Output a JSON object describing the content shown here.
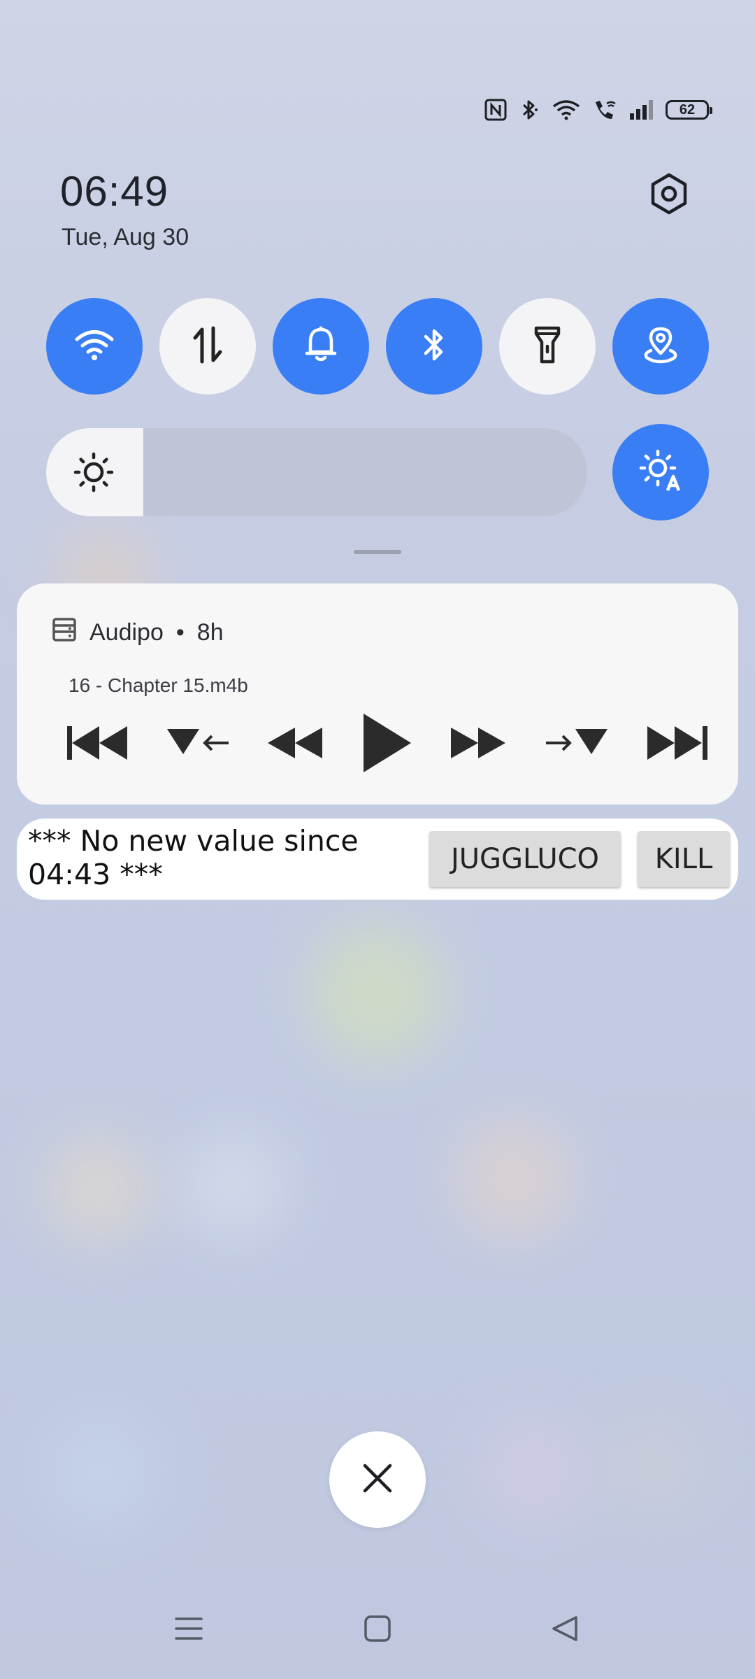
{
  "status_bar": {
    "icons": [
      "nfc-icon",
      "bluetooth-icon",
      "wifi-icon",
      "wifi-call-icon",
      "signal-icon"
    ],
    "battery": "62"
  },
  "header": {
    "time": "06:49",
    "date": "Tue, Aug 30",
    "settings_icon": "gear-icon"
  },
  "quick_tiles": [
    {
      "name": "wifi",
      "icon": "wifi-icon",
      "active": true
    },
    {
      "name": "mobile-data",
      "icon": "data-arrows-icon",
      "active": false
    },
    {
      "name": "sound",
      "icon": "bell-icon",
      "active": true
    },
    {
      "name": "bluetooth",
      "icon": "bluetooth-icon",
      "active": true
    },
    {
      "name": "flashlight",
      "icon": "flashlight-icon",
      "active": false
    },
    {
      "name": "location",
      "icon": "location-icon",
      "active": true
    }
  ],
  "brightness": {
    "level": 0.18,
    "auto": true
  },
  "media": {
    "app": "Audipo",
    "separator": "•",
    "age": "8h",
    "track": "16 - Chapter 15.m4b",
    "controls": [
      "skip-previous-icon",
      "jump-back-icon",
      "rewind-icon",
      "play-icon",
      "fast-forward-icon",
      "jump-forward-icon",
      "skip-next-icon"
    ]
  },
  "juggluco": {
    "message": "***  No new value since 04:43 ***",
    "button_app": "JUGGLUCO",
    "button_kill": "KILL"
  },
  "colors": {
    "accent": "#3a7ef5",
    "tile_off": "#f4f4f6",
    "card": "#f7f7f8"
  }
}
